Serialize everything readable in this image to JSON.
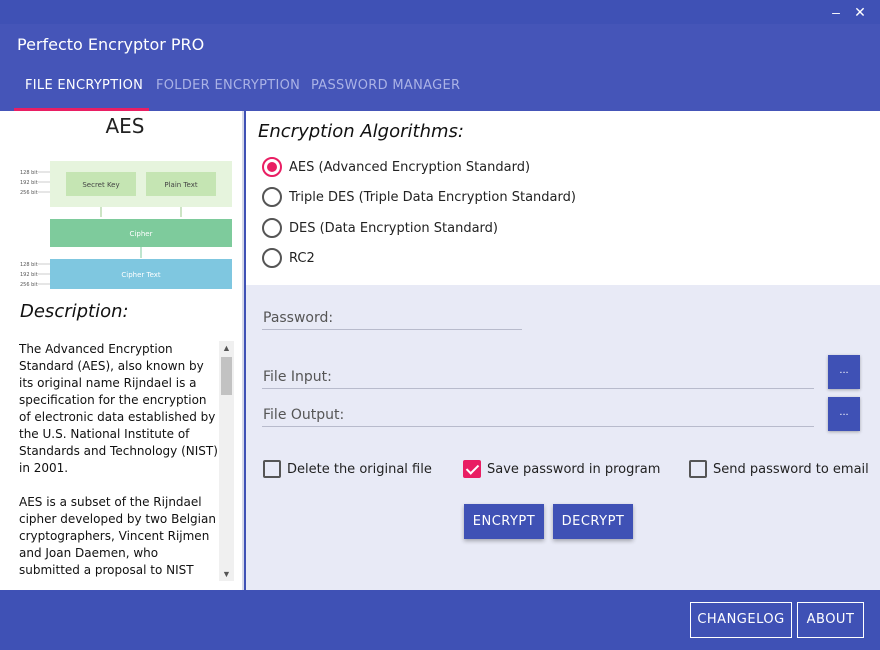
{
  "window": {
    "minimize_glyph": "–",
    "close_glyph": "✕"
  },
  "app": {
    "title": "Perfecto Encryptor PRO"
  },
  "tabs": [
    {
      "label": "FILE ENCRYPTION",
      "active": true
    },
    {
      "label": "FOLDER ENCRYPTION",
      "active": false
    },
    {
      "label": "PASSWORD MANAGER",
      "active": false
    }
  ],
  "left": {
    "algorithm_title": "AES",
    "diagram": {
      "bit_labels_top": [
        "128 bit",
        "192 bit",
        "256 bit"
      ],
      "bit_labels_bottom": [
        "128 bit",
        "192 bit",
        "256 bit"
      ],
      "secret_key": "Secret Key",
      "plain_text": "Plain Text",
      "cipher": "Cipher",
      "cipher_text": "Cipher Text",
      "colors": {
        "light_green": "#e6f4dd",
        "box_green": "#c5e5b3",
        "cipher_green": "#7ecb9c",
        "cipher_text_blue": "#7fc7e0"
      }
    },
    "description_heading": "Description:",
    "description_text": "The Advanced Encryption Standard (AES), also known by its original name Rijndael is a specification for the encryption of electronic data established by the U.S. National Institute of Standards and Technology (NIST) in 2001.\n\nAES is a subset of the Rijndael cipher developed by two Belgian cryptographers, Vincent Rijmen and Joan Daemen, who submitted a proposal to NIST"
  },
  "algorithms": {
    "heading": "Encryption Algorithms:",
    "options": [
      {
        "label": "AES (Advanced Encryption Standard)",
        "selected": true
      },
      {
        "label": "Triple DES (Triple Data Encryption Standard)",
        "selected": false
      },
      {
        "label": "DES (Data Encryption Standard)",
        "selected": false
      },
      {
        "label": "RC2",
        "selected": false
      }
    ]
  },
  "form": {
    "password_label": "Password:",
    "file_input_label": "File Input:",
    "file_output_label": "File Output:",
    "browse_label": "...",
    "delete_original_label": "Delete the original file",
    "delete_original_checked": false,
    "save_password_label": "Save password in program",
    "save_password_checked": true,
    "send_email_label": "Send password to email",
    "send_email_checked": false,
    "encrypt_label": "ENCRYPT",
    "decrypt_label": "DECRYPT"
  },
  "footer": {
    "changelog_label": "CHANGELOG",
    "about_label": "ABOUT"
  },
  "colors": {
    "primary": "#3f51b5",
    "accent": "#e91e63",
    "panel_bg": "#e8eaf6"
  }
}
